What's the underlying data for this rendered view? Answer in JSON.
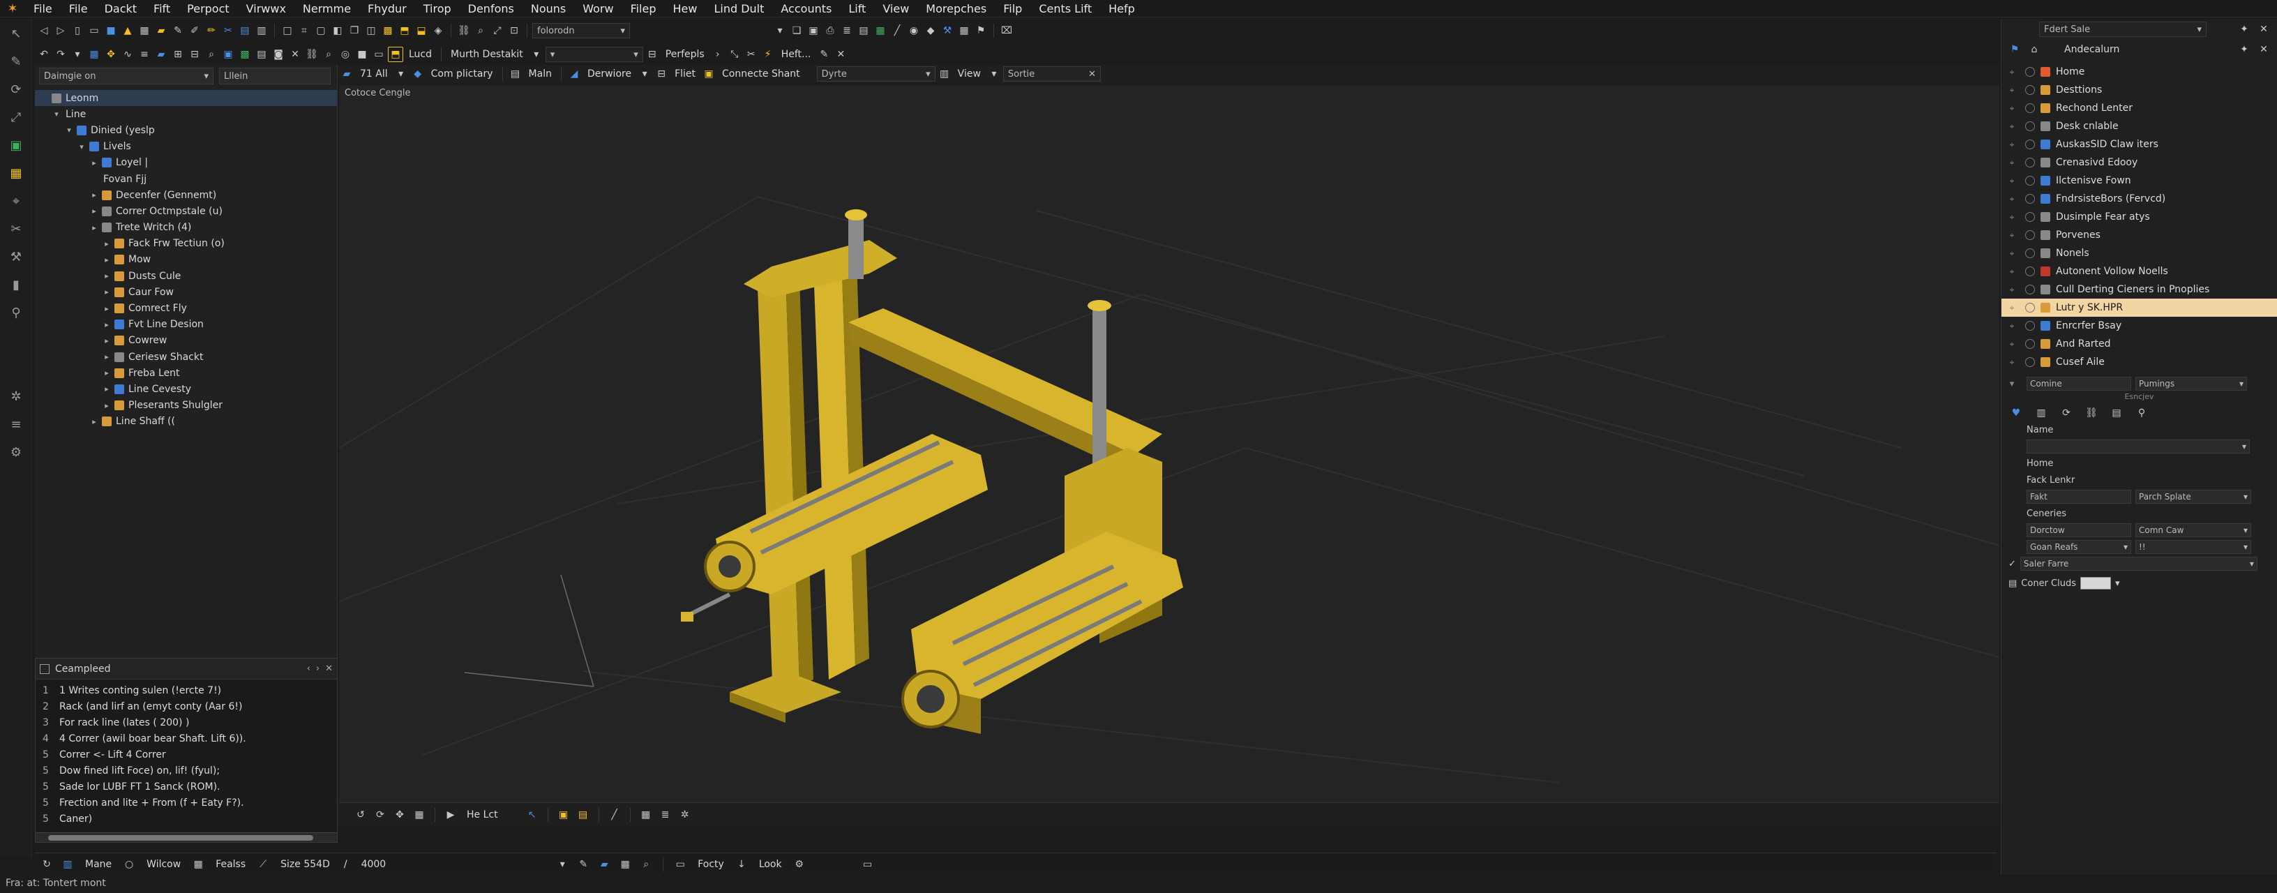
{
  "menu": {
    "items": [
      "File",
      "File",
      "Dackt",
      "Fift",
      "Perpoct",
      "Virwwx",
      "Nermme",
      "Fhydur",
      "Tirop",
      "Denfons",
      "Nouns",
      "Worw",
      "Filep",
      "Hew",
      "Lind Dult",
      "Accounts",
      "Lift",
      "View",
      "Morepches",
      "Filp",
      "Cents Lift",
      "Hefp"
    ]
  },
  "toolbar": {
    "tb1_drop": "folorodn",
    "tb2_mode": "Lucd",
    "tb2_desk": "Murth Destakit",
    "tb2_prefs": "Perfepls",
    "tb2_heft": "Heft...",
    "tb3_count": "71 All",
    "tb3_tabs": [
      "Com plictary",
      "Maln",
      "Derwiore",
      "Fliet",
      "Connecte Shant"
    ],
    "tb3_style": "Dyrte",
    "tb3_view": "View",
    "tb3_sort": "Sortie"
  },
  "outliner": {
    "filter_left": "Daimgie on",
    "filter_right": "Lllein",
    "rows": [
      {
        "label": "Leonm",
        "indent": 0,
        "arrow": "",
        "icon": "grey",
        "sel": true
      },
      {
        "label": "Line",
        "indent": 1,
        "arrow": "▾",
        "icon": "none"
      },
      {
        "label": "Dinied (yeslp",
        "indent": 2,
        "arrow": "▾",
        "icon": "blue"
      },
      {
        "label": "Livels",
        "indent": 3,
        "arrow": "▾",
        "icon": "blue"
      },
      {
        "label": "Loyel |",
        "indent": 4,
        "arrow": "▸",
        "icon": "blue"
      },
      {
        "label": "Fovan Fjj",
        "indent": 4,
        "arrow": "",
        "icon": "none"
      },
      {
        "label": "Decenfer (Gennemt)",
        "indent": 4,
        "arrow": "▸",
        "icon": "fold"
      },
      {
        "label": "Correr Octmpstale (u)",
        "indent": 4,
        "arrow": "▸",
        "icon": "grey"
      },
      {
        "label": "Trete Writch (4)",
        "indent": 4,
        "arrow": "▸",
        "icon": "grey"
      },
      {
        "label": "Fack Frw Tectiun (o)",
        "indent": 5,
        "arrow": "▸",
        "icon": "fold"
      },
      {
        "label": "Mow",
        "indent": 5,
        "arrow": "▸",
        "icon": "fold"
      },
      {
        "label": "Dusts Cule",
        "indent": 5,
        "arrow": "▸",
        "icon": "fold"
      },
      {
        "label": "Caur Fow",
        "indent": 5,
        "arrow": "▸",
        "icon": "fold"
      },
      {
        "label": "Comrect Fly",
        "indent": 5,
        "arrow": "▸",
        "icon": "fold"
      },
      {
        "label": "Fvt Line Desion",
        "indent": 5,
        "arrow": "▸",
        "icon": "blue"
      },
      {
        "label": "Cowrew",
        "indent": 5,
        "arrow": "▸",
        "icon": "fold"
      },
      {
        "label": "Ceriesw Shackt",
        "indent": 5,
        "arrow": "▸",
        "icon": "grey"
      },
      {
        "label": "Freba Lent",
        "indent": 5,
        "arrow": "▸",
        "icon": "fold"
      },
      {
        "label": "Line Cevesty",
        "indent": 5,
        "arrow": "▸",
        "icon": "blue"
      },
      {
        "label": "Pleserants Shulgler",
        "indent": 5,
        "arrow": "▸",
        "icon": "fold"
      },
      {
        "label": "Line Shaff ((",
        "indent": 4,
        "arrow": "▸",
        "icon": "fold"
      }
    ]
  },
  "console": {
    "title": "Ceampleed",
    "lines": [
      {
        "n": "1",
        "text": "1 Writes conting sulen (!ercte 7!)"
      },
      {
        "n": "2",
        "text": "Rack (and lirf an (emyt conty (Aar 6!)"
      },
      {
        "n": "3",
        "text": "For rack line (lates ( 200) )"
      },
      {
        "n": "4",
        "text": "4 Correr (awil boar bear Shaft. Lift 6))."
      },
      {
        "n": "5",
        "text": "Correr <- Lift 4 Correr"
      },
      {
        "n": "5",
        "text": "Dow fined lift Foce) on, lif! (fyul);"
      },
      {
        "n": "5",
        "text": "Sade lor LUBF FT 1 Sanck (ROM)."
      },
      {
        "n": "5",
        "text": "Frection and lite + From (f + Eaty F?)."
      },
      {
        "n": "5",
        "text": "Caner)"
      }
    ]
  },
  "viewport": {
    "label": "Cotoce Cengle",
    "bottom_label": "He Lct"
  },
  "status": {
    "mane": "Mane",
    "wilcow": "Wilcow",
    "fealss": "Fealss",
    "size": "Size 554D",
    "total": "4000",
    "focty": "Focty",
    "look": "Look",
    "bottom_text": "Fra: at: Tontert mont"
  },
  "rightpanel": {
    "top_drop": "Fdert Sale",
    "tab_label": "Andecalurn",
    "rows": [
      {
        "label": "Home",
        "icon": "#e05a2a"
      },
      {
        "label": "Desttions",
        "icon": "#d89b3a"
      },
      {
        "label": "Rechond Lenter",
        "icon": "#d89b3a"
      },
      {
        "label": "Desk cnlable",
        "icon": "#888"
      },
      {
        "label": "AuskasSID Claw iters",
        "icon": "#3d7bd4"
      },
      {
        "label": "Crenasivd Edooy",
        "icon": "#888"
      },
      {
        "label": "Ilctenisve Fown",
        "icon": "#3d7bd4"
      },
      {
        "label": "FndrsisteBors (Fervcd)",
        "icon": "#3d7bd4"
      },
      {
        "label": "Dusimple Fear atys",
        "icon": "#888"
      },
      {
        "label": "Porvenes",
        "icon": "#888"
      },
      {
        "label": "Nonels",
        "icon": "#888"
      },
      {
        "label": "Autonent Vollow Noells",
        "icon": "#c0392b"
      },
      {
        "label": "Cull Derting Cieners in Pnoplies",
        "icon": "#888"
      },
      {
        "label": "Lutr y SK.HPR",
        "icon": "#d89b3a",
        "sel": true
      },
      {
        "label": "Enrcrfer Bsay",
        "icon": "#3d7bd4"
      },
      {
        "label": "And Rarted",
        "icon": "#d89b3a"
      },
      {
        "label": "Cusef Aile",
        "icon": "#d89b3a"
      }
    ],
    "comine": "Comine",
    "pumings": "Pumings",
    "sub_label": "Esncjev",
    "props": {
      "name_label": "Name",
      "home": "Home",
      "fack_lenter": "Fack Lenkr",
      "fakt": "Fakt",
      "parch": "Parch Splate",
      "ceneries": "Ceneries",
      "dorctow": "Dorctow",
      "comn_caw": "Comn Caw",
      "goan_reafs": "Goan Reafs",
      "goan_val": "!!",
      "saler_farre": "Saler Farre",
      "coner_cluds": "Coner Cluds"
    }
  }
}
